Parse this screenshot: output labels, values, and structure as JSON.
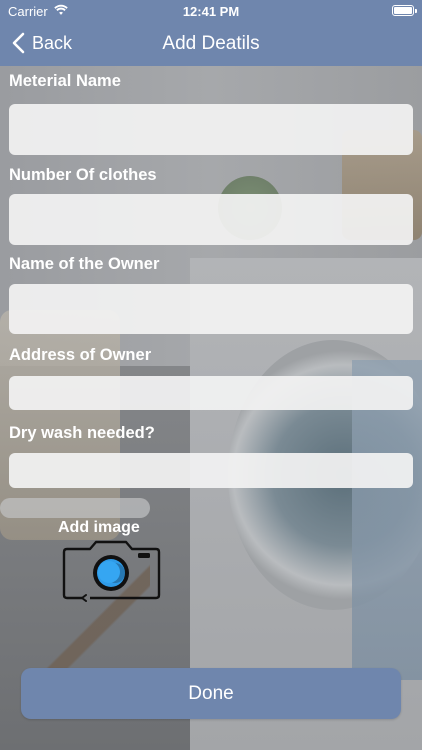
{
  "status_bar": {
    "carrier": "Carrier",
    "time": "12:41 PM"
  },
  "nav": {
    "back_label": "Back",
    "title": "Add Deatils"
  },
  "form": {
    "material_label": "Meterial Name",
    "material_value": "",
    "clothes_label": "Number Of clothes",
    "clothes_value": "",
    "owner_label": "Name of the Owner",
    "owner_value": "",
    "address_label": "Address of Owner",
    "address_value": "",
    "drywash_label": "Dry wash needed?",
    "drywash_value": ""
  },
  "add_image": {
    "label": "Add image"
  },
  "done": {
    "label": "Done"
  },
  "colors": {
    "accent": "#6f86ad",
    "field_bg": "#f2f2f2",
    "camera_lens": "#2f9be8"
  },
  "icons": [
    "wifi-icon",
    "battery-icon",
    "chevron-left-icon",
    "camera-icon"
  ]
}
